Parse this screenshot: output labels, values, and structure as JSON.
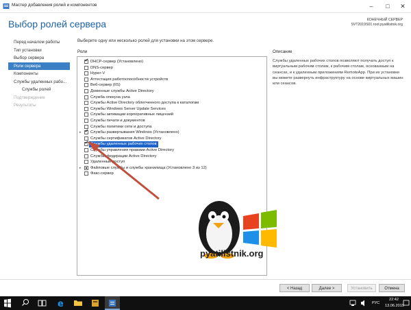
{
  "window": {
    "title": "Мастер добавления ролей и компонентов"
  },
  "header": {
    "title": "Выбор ролей сервера",
    "dest_label": "КОНЕЧНЫЙ СЕРВЕР",
    "dest_server": "SVT2019S01.root.pyatilistnik.org"
  },
  "nav": {
    "items": [
      {
        "label": "Перед началом работы",
        "state": "normal"
      },
      {
        "label": "Тип установки",
        "state": "normal"
      },
      {
        "label": "Выбор сервера",
        "state": "normal"
      },
      {
        "label": "Роли сервера",
        "state": "active"
      },
      {
        "label": "Компоненты",
        "state": "normal"
      },
      {
        "label": "Службы удаленных рабо...",
        "state": "normal"
      },
      {
        "label": "Службы ролей",
        "state": "sub"
      },
      {
        "label": "Подтверждение",
        "state": "disabled"
      },
      {
        "label": "Результаты",
        "state": "disabled"
      }
    ]
  },
  "main": {
    "instruction": "Выберите одну или несколько ролей для установки на этом сервере.",
    "roles_label": "Роли"
  },
  "roles": [
    {
      "label": "DHCP-сервер (Установлено)",
      "state": "checked",
      "expander": false
    },
    {
      "label": "DNS-сервер",
      "state": "unchecked",
      "expander": false
    },
    {
      "label": "Hyper-V",
      "state": "unchecked",
      "expander": false
    },
    {
      "label": "Аттестация работоспособности устройств",
      "state": "unchecked",
      "expander": false
    },
    {
      "label": "Веб-сервер (IIS)",
      "state": "unchecked",
      "expander": false
    },
    {
      "label": "Доменные службы Active Directory",
      "state": "unchecked",
      "expander": false
    },
    {
      "label": "Служба опекуна узла",
      "state": "unchecked",
      "expander": false
    },
    {
      "label": "Службы Active Directory облегченного доступа к каталогам",
      "state": "unchecked",
      "expander": false
    },
    {
      "label": "Службы Windows Server Update Services",
      "state": "unchecked",
      "expander": false
    },
    {
      "label": "Службы активации корпоративных лицензий",
      "state": "unchecked",
      "expander": false
    },
    {
      "label": "Службы печати и документов",
      "state": "unchecked",
      "expander": false
    },
    {
      "label": "Службы политики сети и доступа",
      "state": "unchecked",
      "expander": false
    },
    {
      "label": "Службы развертывания Windows (Установлено)",
      "state": "checked",
      "expander": true
    },
    {
      "label": "Службы сертификатов Active Directory",
      "state": "unchecked",
      "expander": false
    },
    {
      "label": "Службы удаленных рабочих столов",
      "state": "checked",
      "expander": false,
      "selected": true
    },
    {
      "label": "Службы управления правами Active Directory",
      "state": "unchecked",
      "expander": false
    },
    {
      "label": "Службы федерации Active Directory",
      "state": "unchecked",
      "expander": false
    },
    {
      "label": "Удаленный доступ",
      "state": "unchecked",
      "expander": false
    },
    {
      "label": "Файловые службы и службы хранилища (Установлено 3 из 12)",
      "state": "partial",
      "expander": true
    },
    {
      "label": "Факс-сервер",
      "state": "unchecked",
      "expander": false
    }
  ],
  "description": {
    "label": "Описание",
    "text": "Службы удаленных рабочих столов позволяют получать доступ к виртуальным рабочим столам, к рабочим столам, основанным на сеансах, и к удаленным приложениям RemoteApp. При их установке вы можете развернуть инфраструктуру на основе виртуальных машин или сеансов."
  },
  "watermark": {
    "text": "pyatilistnik.org"
  },
  "buttons": {
    "back": "< Назад",
    "next": "Далее >",
    "install": "Установить",
    "cancel": "Отмена"
  },
  "taskbar": {
    "lang": "РУС",
    "time": "22:42",
    "date": "13.06.2019"
  },
  "colors": {
    "accent": "#1e63a6",
    "nav_active": "#3b7fc4",
    "selection": "#1e63c9",
    "arrow": "#c0503d"
  }
}
